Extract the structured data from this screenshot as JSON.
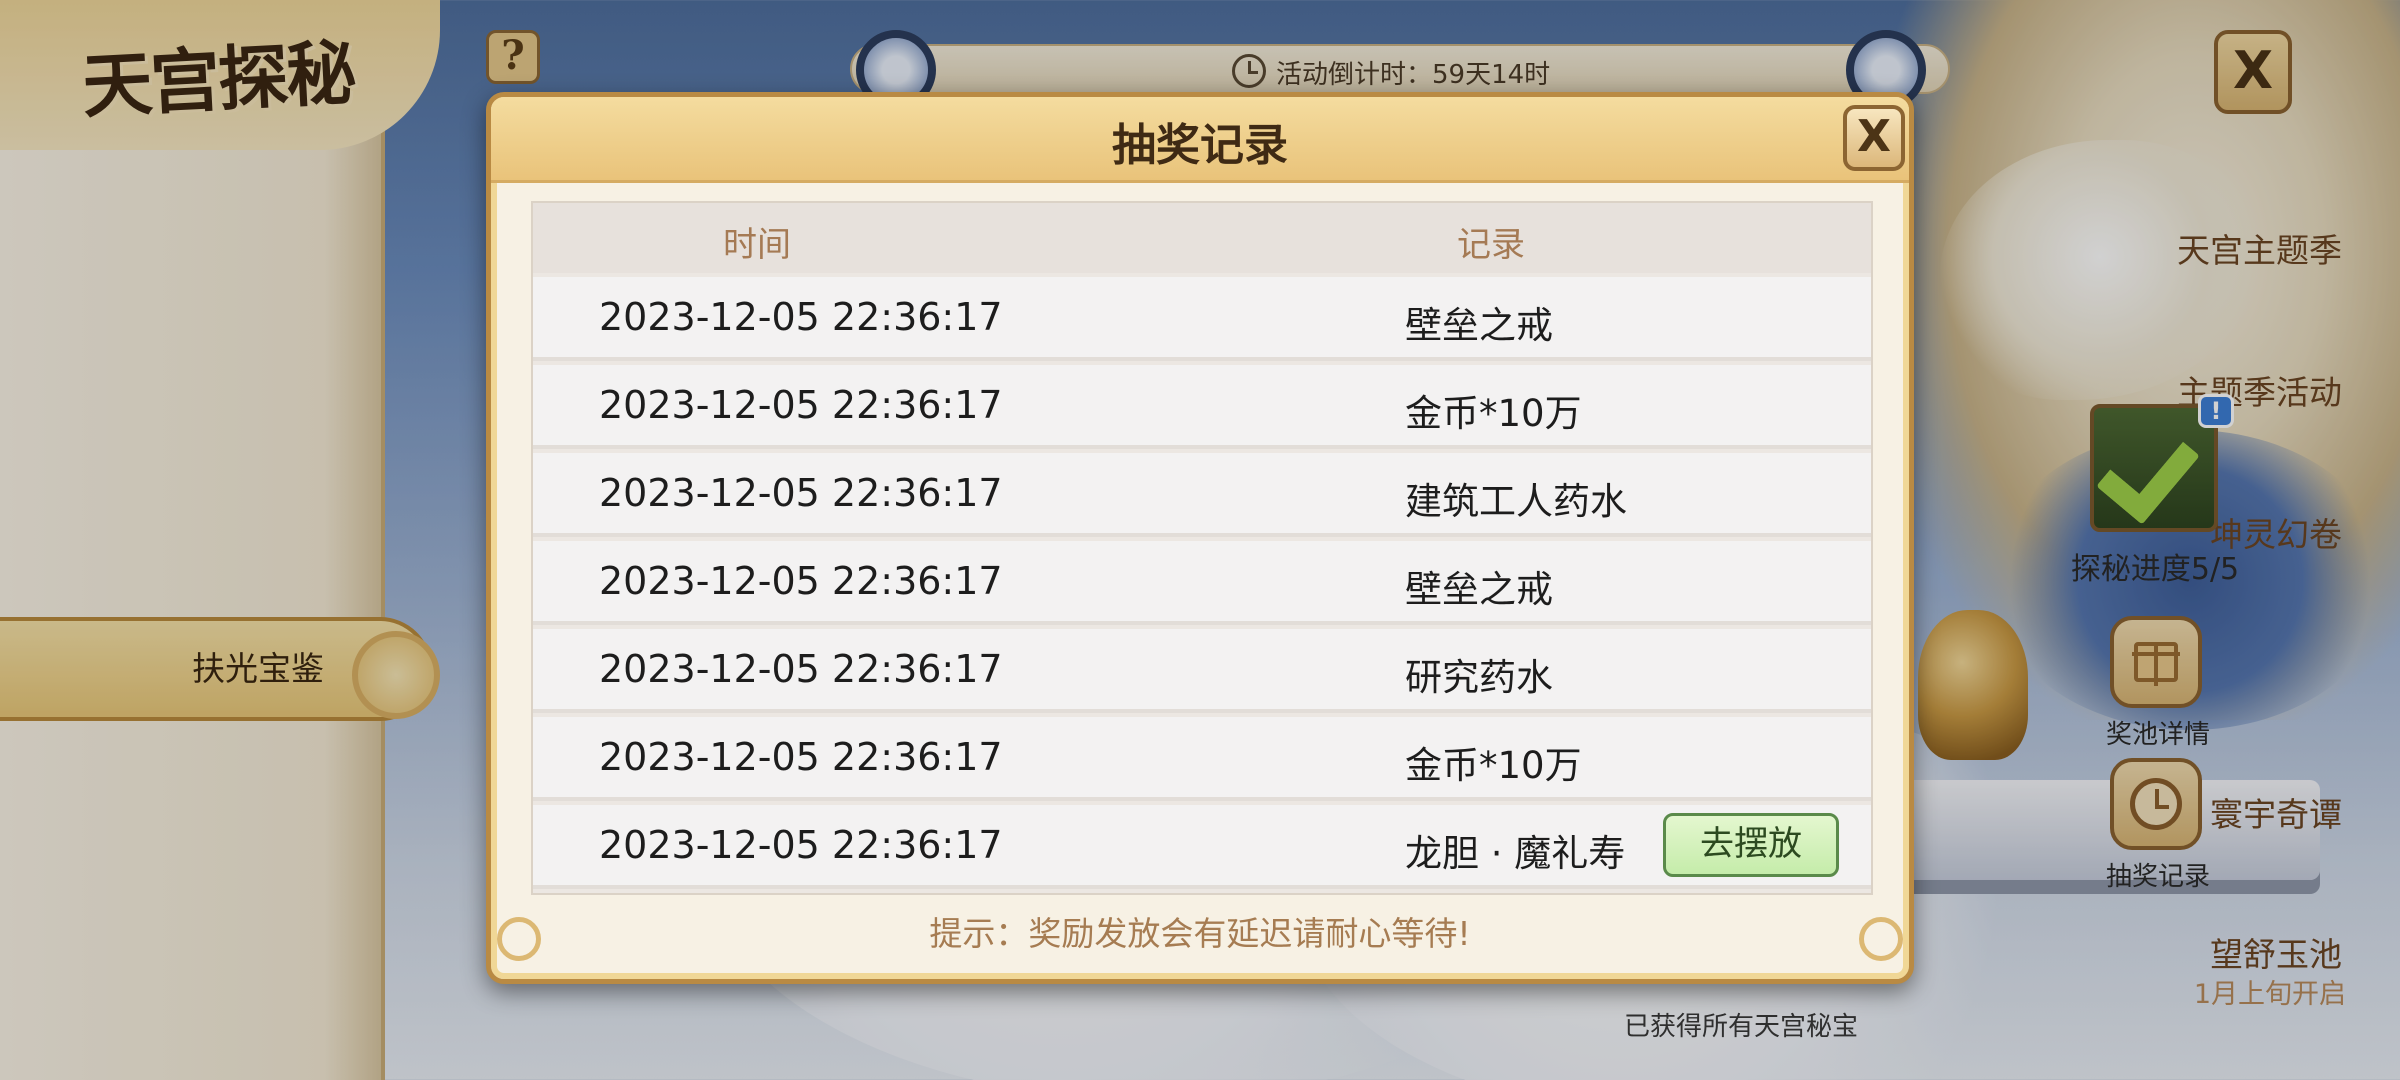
{
  "page": {
    "logo": "天宫探秘",
    "help_icon": "?",
    "close_icon": "X",
    "timer_text": "活动倒计时：59天14时"
  },
  "sidebar": {
    "items": [
      {
        "label": "天宫主题季"
      },
      {
        "label": "主题季活动"
      },
      {
        "label": "坤灵幻卷"
      },
      {
        "label": "扶光宝鉴"
      },
      {
        "label": "寰宇奇谭"
      },
      {
        "label": "望舒玉池"
      }
    ],
    "active_index": 3,
    "last_item_sub": "1月上旬开启"
  },
  "right_panel": {
    "progress_label": "探秘进度5/5",
    "alert_badge": "!",
    "pool_label": "奖池详情",
    "history_label": "抽奖记录",
    "bottom_note": "已获得所有天宫秘宝"
  },
  "modal": {
    "title": "抽奖记录",
    "close_label": "X",
    "columns": [
      "时间",
      "记录"
    ],
    "rows": [
      {
        "time": "2023-12-05 22:36:17",
        "record": "壁垒之戒"
      },
      {
        "time": "2023-12-05 22:36:17",
        "record": "金币*10万"
      },
      {
        "time": "2023-12-05 22:36:17",
        "record": "建筑工人药水"
      },
      {
        "time": "2023-12-05 22:36:17",
        "record": "壁垒之戒"
      },
      {
        "time": "2023-12-05 22:36:17",
        "record": "研究药水"
      },
      {
        "time": "2023-12-05 22:36:17",
        "record": "金币*10万"
      },
      {
        "time": "2023-12-05 22:36:17",
        "record": "龙胆 · 魔礼寿",
        "action": "去摆放"
      }
    ],
    "tip": "提示：奖励发放会有延迟请耐心等待!"
  },
  "colors": {
    "accent_gold": "#e9c37a",
    "title_brown": "#3f2a14",
    "tip_brown": "#a67c52",
    "action_green": "#c5ecaa"
  }
}
